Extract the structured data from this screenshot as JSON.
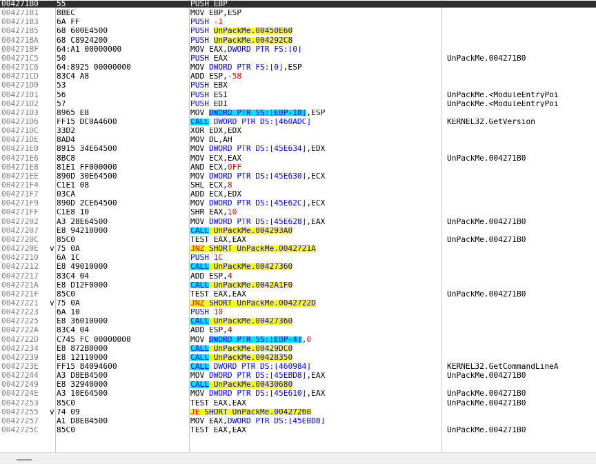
{
  "rows": [
    {
      "addr": "004271B0",
      "bytes": "55",
      "jmp": "",
      "asm": [
        [
          "PUSH ",
          "mn"
        ],
        [
          "EBP",
          ""
        ]
      ],
      "comment": "",
      "selected": true
    },
    {
      "addr": "004271B1",
      "bytes": "8BEC",
      "jmp": "",
      "asm": [
        [
          "MOV ",
          "mn"
        ],
        [
          "EBP,ESP",
          ""
        ]
      ],
      "comment": ""
    },
    {
      "addr": "004271B3",
      "bytes": "6A FF",
      "jmp": "",
      "asm": [
        [
          "PUSH ",
          "mnb"
        ],
        [
          "-1",
          "num"
        ]
      ],
      "comment": ""
    },
    {
      "addr": "004271B5",
      "bytes": "68 600E4500",
      "jmp": "",
      "asm": [
        [
          "PUSH ",
          "mnb"
        ],
        [
          "UnPackMe.00450E60",
          "yellow"
        ]
      ],
      "comment": ""
    },
    {
      "addr": "004271BA",
      "bytes": "68 C8924200",
      "jmp": "",
      "asm": [
        [
          "PUSH ",
          "mnb"
        ],
        [
          "UnPackMe.004292C8",
          "yellow"
        ]
      ],
      "comment": ""
    },
    {
      "addr": "004271BF",
      "bytes": "64:A1 00000000",
      "jmp": "",
      "asm": [
        [
          "MOV ",
          "mn"
        ],
        [
          "EAX,",
          ""
        ],
        [
          "DWORD PTR FS:[0]",
          "blue"
        ]
      ],
      "comment": ""
    },
    {
      "addr": "004271C5",
      "bytes": "50",
      "jmp": "",
      "asm": [
        [
          "PUSH ",
          "mnb"
        ],
        [
          "EAX",
          ""
        ]
      ],
      "comment": "UnPackMe.004271B0"
    },
    {
      "addr": "004271C6",
      "bytes": "64:8925 00000000",
      "jmp": "",
      "asm": [
        [
          "MOV ",
          "mn"
        ],
        [
          "DWORD PTR FS:[0]",
          "blue"
        ],
        [
          ",ESP",
          ""
        ]
      ],
      "comment": ""
    },
    {
      "addr": "004271CD",
      "bytes": "83C4 A8",
      "jmp": "",
      "asm": [
        [
          "ADD ",
          "mn"
        ],
        [
          "ESP,",
          ""
        ],
        [
          "-58",
          "num"
        ]
      ],
      "comment": ""
    },
    {
      "addr": "004271D0",
      "bytes": "53",
      "jmp": "",
      "asm": [
        [
          "PUSH ",
          "mnb"
        ],
        [
          "EBX",
          ""
        ]
      ],
      "comment": ""
    },
    {
      "addr": "004271D1",
      "bytes": "56",
      "jmp": "",
      "asm": [
        [
          "PUSH ",
          "mnb"
        ],
        [
          "ESI",
          ""
        ]
      ],
      "comment": "UnPackMe.<ModuleEntryPoi"
    },
    {
      "addr": "004271D2",
      "bytes": "57",
      "jmp": "",
      "asm": [
        [
          "PUSH ",
          "mnb"
        ],
        [
          "EDI",
          ""
        ]
      ],
      "comment": "UnPackMe.<ModuleEntryPoi"
    },
    {
      "addr": "004271D3",
      "bytes": "8965 E8",
      "jmp": "",
      "asm": [
        [
          "MOV ",
          "mn"
        ],
        [
          "DWORD PTR SS:[EBP-18]",
          "cyan"
        ],
        [
          ",ESP",
          ""
        ]
      ],
      "comment": ""
    },
    {
      "addr": "004271D6",
      "bytes": "FF15 DC0A4600",
      "jmp": "",
      "asm": [
        [
          "CALL",
          "call"
        ],
        [
          " DWORD PTR DS:[460ADC]",
          "blue"
        ]
      ],
      "comment": "KERNEL32.GetVersion"
    },
    {
      "addr": "004271DC",
      "bytes": "33D2",
      "jmp": "",
      "asm": [
        [
          "XOR ",
          "mn"
        ],
        [
          "EDX,EDX",
          ""
        ]
      ],
      "comment": ""
    },
    {
      "addr": "004271DE",
      "bytes": "8AD4",
      "jmp": "",
      "asm": [
        [
          "MOV ",
          "mn"
        ],
        [
          "DL,AH",
          ""
        ]
      ],
      "comment": ""
    },
    {
      "addr": "004271E0",
      "bytes": "8915 34E64500",
      "jmp": "",
      "asm": [
        [
          "MOV ",
          "mn"
        ],
        [
          "DWORD PTR DS:[45E634]",
          "blue"
        ],
        [
          ",EDX",
          ""
        ]
      ],
      "comment": ""
    },
    {
      "addr": "004271E6",
      "bytes": "8BC8",
      "jmp": "",
      "asm": [
        [
          "MOV ",
          "mn"
        ],
        [
          "ECX,EAX",
          ""
        ]
      ],
      "comment": "UnPackMe.004271B0"
    },
    {
      "addr": "004271E8",
      "bytes": "81E1 FF000000",
      "jmp": "",
      "asm": [
        [
          "AND ",
          "mn"
        ],
        [
          "ECX,",
          ""
        ],
        [
          "0FF",
          "num"
        ]
      ],
      "comment": ""
    },
    {
      "addr": "004271EE",
      "bytes": "890D 30E64500",
      "jmp": "",
      "asm": [
        [
          "MOV ",
          "mn"
        ],
        [
          "DWORD PTR DS:[45E630]",
          "blue"
        ],
        [
          ",ECX",
          ""
        ]
      ],
      "comment": ""
    },
    {
      "addr": "004271F4",
      "bytes": "C1E1 08",
      "jmp": "",
      "asm": [
        [
          "SHL ",
          "mn"
        ],
        [
          "ECX,",
          ""
        ],
        [
          "8",
          "num"
        ]
      ],
      "comment": ""
    },
    {
      "addr": "004271F7",
      "bytes": "03CA",
      "jmp": "",
      "asm": [
        [
          "ADD ",
          "mn"
        ],
        [
          "ECX,EDX",
          ""
        ]
      ],
      "comment": ""
    },
    {
      "addr": "004271F9",
      "bytes": "890D 2CE64500",
      "jmp": "",
      "asm": [
        [
          "MOV ",
          "mn"
        ],
        [
          "DWORD PTR DS:[45E62C]",
          "blue"
        ],
        [
          ",ECX",
          ""
        ]
      ],
      "comment": ""
    },
    {
      "addr": "004271FF",
      "bytes": "C1E8 10",
      "jmp": "",
      "asm": [
        [
          "SHR ",
          "mn"
        ],
        [
          "EAX,",
          ""
        ],
        [
          "10",
          "num"
        ]
      ],
      "comment": ""
    },
    {
      "addr": "00427202",
      "bytes": "A3 28E64500",
      "jmp": "",
      "asm": [
        [
          "MOV ",
          "mn"
        ],
        [
          "DWORD PTR DS:[45E628]",
          "blue"
        ],
        [
          ",EAX",
          ""
        ]
      ],
      "comment": "UnPackMe.004271B0"
    },
    {
      "addr": "00427207",
      "bytes": "E8 94210000",
      "jmp": "",
      "asm": [
        [
          "CALL",
          "call"
        ],
        [
          " UnPackMe.004293A0",
          "yellow"
        ]
      ],
      "comment": ""
    },
    {
      "addr": "0042720C",
      "bytes": "85C0",
      "jmp": "",
      "asm": [
        [
          "TEST ",
          "mn"
        ],
        [
          "EAX,EAX",
          ""
        ]
      ],
      "comment": "UnPackMe.004271B0"
    },
    {
      "addr": "0042720E",
      "bytes": "75 0A",
      "jmp": "v",
      "asm": [
        [
          "JNZ",
          "jcc"
        ],
        [
          " SHORT UnPackMe.0042721A",
          "yellow"
        ]
      ],
      "comment": ""
    },
    {
      "addr": "00427210",
      "bytes": "6A 1C",
      "jmp": "",
      "asm": [
        [
          "PUSH ",
          "mnb"
        ],
        [
          "1C",
          "num"
        ]
      ],
      "comment": ""
    },
    {
      "addr": "00427212",
      "bytes": "E8 49010000",
      "jmp": "",
      "asm": [
        [
          "CALL",
          "call"
        ],
        [
          " UnPackMe.00427360",
          "yellow"
        ]
      ],
      "comment": ""
    },
    {
      "addr": "00427217",
      "bytes": "83C4 04",
      "jmp": "",
      "asm": [
        [
          "ADD ",
          "mn"
        ],
        [
          "ESP,",
          ""
        ],
        [
          "4",
          "num"
        ]
      ],
      "comment": ""
    },
    {
      "addr": "0042721A",
      "bytes": "E8 D12F0000",
      "jmp": "",
      "asm": [
        [
          "CALL",
          "call"
        ],
        [
          " UnPackMe.0042A1F0",
          "yellow"
        ]
      ],
      "comment": ""
    },
    {
      "addr": "0042721F",
      "bytes": "85C0",
      "jmp": "",
      "asm": [
        [
          "TEST ",
          "mn"
        ],
        [
          "EAX,EAX",
          ""
        ]
      ],
      "comment": "UnPackMe.004271B0"
    },
    {
      "addr": "00427221",
      "bytes": "75 0A",
      "jmp": "v",
      "asm": [
        [
          "JNZ",
          "jcc"
        ],
        [
          " SHORT UnPackMe.0042722D",
          "yellow"
        ]
      ],
      "comment": ""
    },
    {
      "addr": "00427223",
      "bytes": "6A 10",
      "jmp": "",
      "asm": [
        [
          "PUSH ",
          "mnb"
        ],
        [
          "10",
          "num"
        ]
      ],
      "comment": ""
    },
    {
      "addr": "00427225",
      "bytes": "E8 36010000",
      "jmp": "",
      "asm": [
        [
          "CALL",
          "call"
        ],
        [
          " UnPackMe.00427360",
          "yellow"
        ]
      ],
      "comment": ""
    },
    {
      "addr": "0042722A",
      "bytes": "83C4 04",
      "jmp": "",
      "asm": [
        [
          "ADD ",
          "mn"
        ],
        [
          "ESP,",
          ""
        ],
        [
          "4",
          "num"
        ]
      ],
      "comment": ""
    },
    {
      "addr": "0042722D",
      "bytes": "C745 FC 00000000",
      "jmp": "",
      "asm": [
        [
          "MOV ",
          "mn"
        ],
        [
          "DWORD PTR SS:[EBP-4]",
          "cyan"
        ],
        [
          ",",
          ""
        ],
        [
          "0",
          "num"
        ]
      ],
      "comment": ""
    },
    {
      "addr": "00427234",
      "bytes": "E8 872B0000",
      "jmp": "",
      "asm": [
        [
          "CALL",
          "call"
        ],
        [
          " UnPackMe.00429DC0",
          "yellow"
        ]
      ],
      "comment": ""
    },
    {
      "addr": "00427239",
      "bytes": "E8 12110000",
      "jmp": "",
      "asm": [
        [
          "CALL",
          "call"
        ],
        [
          " UnPackMe.00428350",
          "yellow"
        ]
      ],
      "comment": ""
    },
    {
      "addr": "0042723E",
      "bytes": "FF15 84094600",
      "jmp": "",
      "asm": [
        [
          "CALL",
          "call"
        ],
        [
          " DWORD PTR DS:[460984]",
          "blue"
        ]
      ],
      "comment": "KERNEL32.GetCommandLineA"
    },
    {
      "addr": "00427244",
      "bytes": "A3 D8EB4500",
      "jmp": "",
      "asm": [
        [
          "MOV ",
          "mn"
        ],
        [
          "DWORD PTR DS:[45EBD8]",
          "blue"
        ],
        [
          ",EAX",
          ""
        ]
      ],
      "comment": "UnPackMe.004271B0"
    },
    {
      "addr": "00427249",
      "bytes": "E8 32940000",
      "jmp": "",
      "asm": [
        [
          "CALL",
          "call"
        ],
        [
          " UnPackMe.00430680",
          "yellow"
        ]
      ],
      "comment": ""
    },
    {
      "addr": "0042724E",
      "bytes": "A3 10E64500",
      "jmp": "",
      "asm": [
        [
          "MOV ",
          "mn"
        ],
        [
          "DWORD PTR DS:[45E610]",
          "blue"
        ],
        [
          ",EAX",
          ""
        ]
      ],
      "comment": "UnPackMe.004271B0"
    },
    {
      "addr": "00427253",
      "bytes": "85C0",
      "jmp": "",
      "asm": [
        [
          "TEST ",
          "mn"
        ],
        [
          "EAX,EAX",
          ""
        ]
      ],
      "comment": "UnPackMe.004271B0"
    },
    {
      "addr": "00427255",
      "bytes": "74 09",
      "jmp": "v",
      "asm": [
        [
          "JE",
          "jcc"
        ],
        [
          " SHORT UnPackMe.00427260",
          "yellow"
        ]
      ],
      "comment": ""
    },
    {
      "addr": "00427257",
      "bytes": "A1 D8EB4500",
      "jmp": "",
      "asm": [
        [
          "MOV ",
          "mn"
        ],
        [
          "EAX,",
          ""
        ],
        [
          "DWORD PTR DS:[45EBD8]",
          "blue"
        ]
      ],
      "comment": ""
    },
    {
      "addr": "0042725C",
      "bytes": "85C0",
      "jmp": "",
      "asm": [
        [
          "TEST ",
          "mn"
        ],
        [
          "EAX,EAX",
          ""
        ]
      ],
      "comment": "UnPackMe.004271B0"
    }
  ],
  "icons": {
    "status_grip": "resize-grip-icon"
  }
}
